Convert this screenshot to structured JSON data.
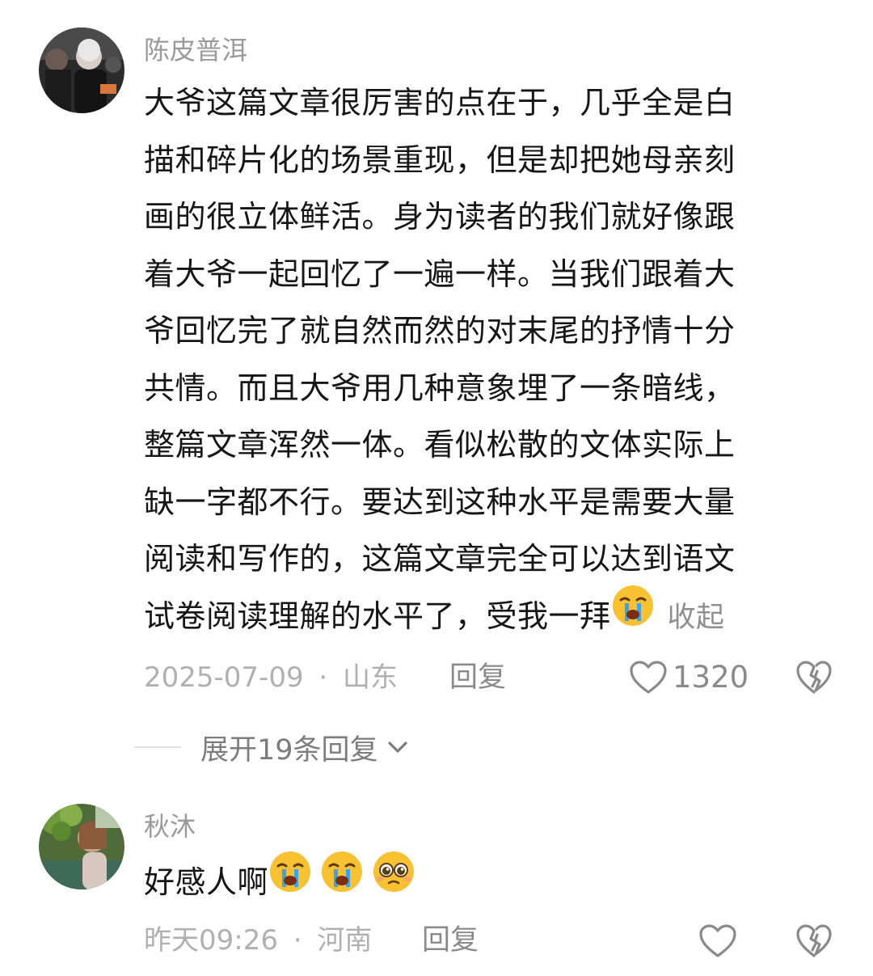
{
  "comments": [
    {
      "username": "陈皮普洱",
      "lines": [
        "大爷这篇文章很厉害的点在于，几乎全是白",
        "描和碎片化的场景重现，但是却把她母亲刻",
        "画的很立体鲜活。身为读者的我们就好像跟",
        "着大爷一起回忆了一遍一样。当我们跟着大",
        "爷回忆完了就自然而然的对末尾的抒情十分",
        "共情。而且大爷用几种意象埋了一条暗线，",
        "整篇文章浑然一体。看似松散的文体实际上",
        "缺一字都不行。要达到这种水平是需要大量",
        "阅读和写作的，这篇文章完全可以达到语文"
      ],
      "last_line": "试卷阅读理解的水平了，受我一拜",
      "trailing_emojis": [
        "crying-face-emoji"
      ],
      "collapse_label": "收起",
      "date": "2025-07-09",
      "separator": "·",
      "location": "山东",
      "reply_label": "回复",
      "like_count": "1320",
      "expand_replies_label": "展开19条回复"
    },
    {
      "username": "秋沐",
      "text": "好感人啊",
      "trailing_emojis": [
        "crying-face-emoji",
        "crying-face-emoji",
        "pleading-face-emoji"
      ],
      "date": "昨天09:26",
      "separator": "·",
      "location": "河南",
      "reply_label": "回复",
      "like_count": ""
    }
  ],
  "colors": {
    "text": "#161616",
    "meta": "#b0b0b0",
    "reply": "#8a8a8a",
    "emoji_yellow": "#f7c132",
    "emoji_tear": "#3aa3f0"
  }
}
